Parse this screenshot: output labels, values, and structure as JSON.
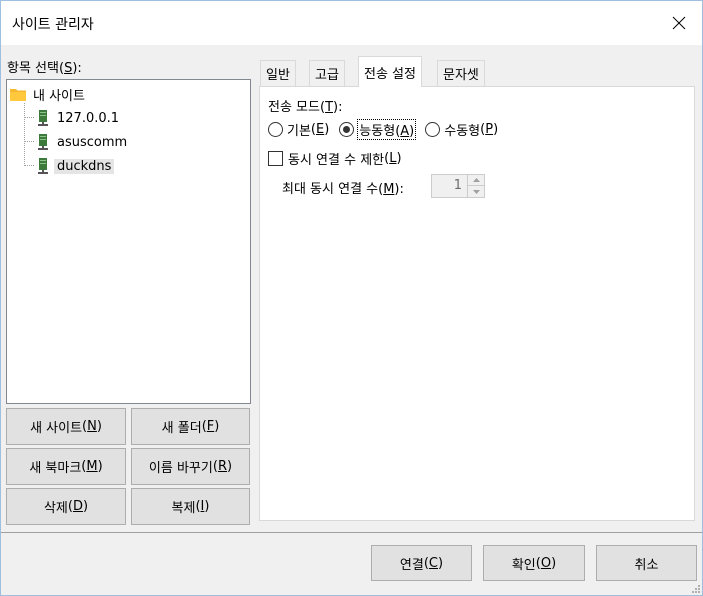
{
  "window": {
    "title": "사이트 관리자"
  },
  "tree": {
    "label": "항목 선택",
    "label_key": "S",
    "root": "내 사이트",
    "items": [
      "127.0.0.1",
      "asuscomm",
      "duckdns"
    ]
  },
  "buttons": {
    "new_site": {
      "text": "새 사이트",
      "key": "N"
    },
    "new_folder": {
      "text": "새 폴더",
      "key": "F"
    },
    "new_bookmark": {
      "text": "새 북마크",
      "key": "M"
    },
    "rename": {
      "text": "이름 바꾸기",
      "key": "R"
    },
    "delete": {
      "text": "삭제",
      "key": "D"
    },
    "duplicate": {
      "text": "복제",
      "key": "I"
    }
  },
  "tabs": [
    "일반",
    "고급",
    "전송 설정",
    "문자셋"
  ],
  "transfer": {
    "mode_label": "전송 모드",
    "mode_key": "T",
    "modes": [
      {
        "text": "기본",
        "key": "E",
        "selected": false
      },
      {
        "text": "능동형",
        "key": "A",
        "selected": true
      },
      {
        "text": "수동형",
        "key": "P",
        "selected": false
      }
    ],
    "limit_label": "동시 연결 수 제한",
    "limit_key": "L",
    "max_label": "최대 동시 연결 수",
    "max_key": "M",
    "max_value": "1"
  },
  "footer": {
    "connect": {
      "text": "연결",
      "key": "C"
    },
    "ok": {
      "text": "확인",
      "key": "O"
    },
    "cancel": "취소"
  },
  "colors": {
    "folder": "#f5b82e",
    "server": "#3c7a3c"
  }
}
